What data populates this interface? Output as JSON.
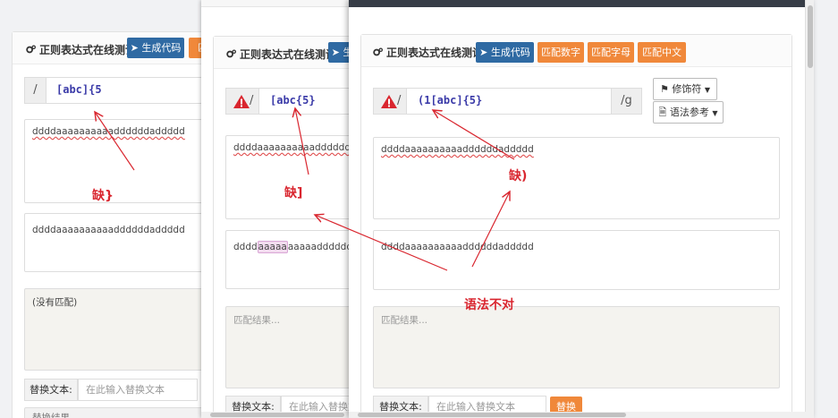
{
  "panel_title": "正则表达式在线测试",
  "buttons": {
    "generate": "生成代码",
    "match_digits": "匹配数字",
    "match_letters": "匹配字母",
    "match_chinese": "匹配中文",
    "replace": "替换",
    "modifier": "修饰符",
    "syntax_ref": "语法参考"
  },
  "windows": {
    "a": {
      "regex_prefix": "/",
      "regex": "[abc]{5",
      "match_result": "(没有匹配)",
      "replace_result_label": "替换结果"
    },
    "b": {
      "regex_prefix": "/",
      "regex": "[abc{5}",
      "match_result_placeholder": "匹配结果..."
    },
    "c": {
      "regex_prefix": "/",
      "regex": "(1[abc]{5}",
      "suffix": "/g",
      "match_result_placeholder": "匹配结果..."
    }
  },
  "sample_text": "ddddaaaaaaaaaaddddddaddddd",
  "sample_text_a": "ddddaaaaaaaaaaddddddaddddd",
  "sample_text_b_pre": "dddd",
  "sample_text_b_hl": "aaaaa",
  "sample_text_b_post": "aaaaaddddddaddddd",
  "sample_text_c_top": "ddddaaaaaaaaaaddddddaddddd",
  "sample_text_c_bottom": "ddddaaaaaaaaaaddddddaddddd",
  "replace": {
    "label": "替换文本:",
    "placeholder": "在此输入替换文本"
  },
  "annotations": {
    "missing_brace": "缺}",
    "missing_bracket": "缺]",
    "missing_paren": "缺)",
    "syntax_wrong": "语法不对"
  },
  "colors": {
    "accent_blue": "#2f6aa3",
    "accent_orange": "#f0883a",
    "annotation_red": "#d9262f",
    "topbar": "#373d47"
  },
  "icons": [
    "cogs-icon",
    "paper-plane-icon",
    "warning-icon",
    "flag-icon",
    "file-icon",
    "caret-down-icon"
  ]
}
